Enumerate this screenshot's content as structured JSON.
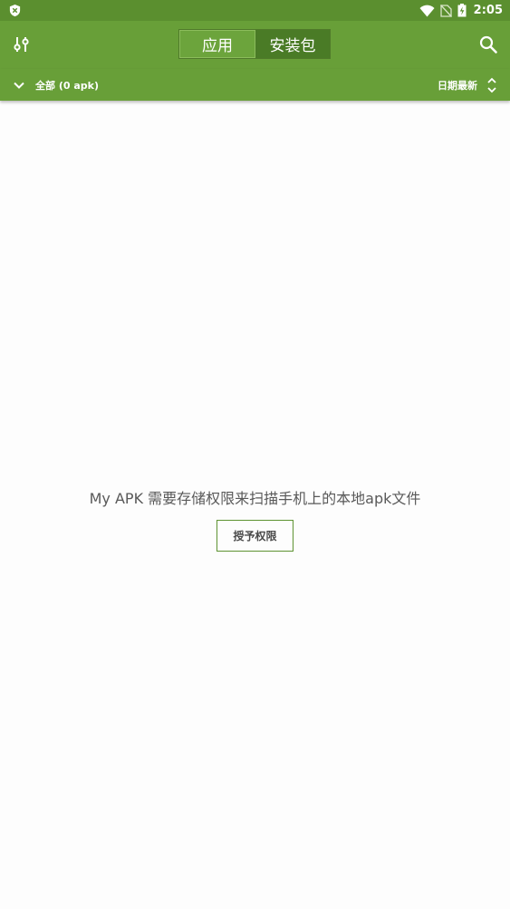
{
  "status_bar": {
    "time": "2:05",
    "icons": [
      "shield-icon",
      "wifi-icon",
      "no-sim-icon",
      "battery-charging-icon"
    ]
  },
  "toolbar": {
    "filter_icon": "tune-icon",
    "search_icon": "search-icon",
    "segments": [
      {
        "label": "应用",
        "selected": true
      },
      {
        "label": "安装包",
        "selected": false
      }
    ]
  },
  "filter_bar": {
    "filter_label": "全部 (0 apk)",
    "sort_label": "日期最新"
  },
  "main": {
    "message": "My APK 需要存储权限来扫描手机上的本地apk文件",
    "grant_button": "授予权限"
  },
  "colors": {
    "status_bar": "#5b8f2f",
    "toolbar": "#689f38",
    "background": "#fdfdfd"
  }
}
